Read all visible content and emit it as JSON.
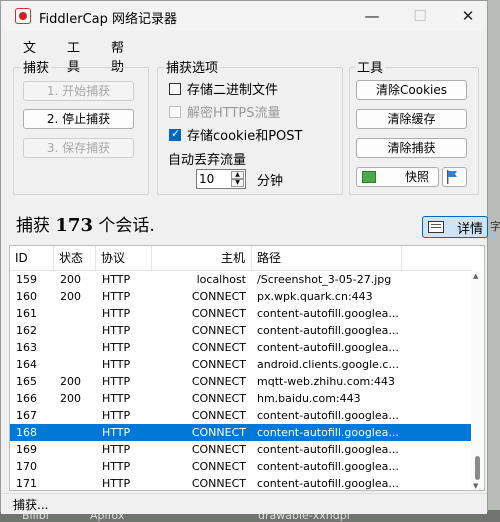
{
  "window": {
    "title": "FiddlerCap 网络记录器",
    "controls": {
      "minimize": "—",
      "maximize": "☐",
      "close": "✕"
    }
  },
  "menu": [
    "文件",
    "工具",
    "帮助"
  ],
  "capture_group": {
    "label": "捕获",
    "buttons": [
      {
        "label": "1. 开始捕获",
        "enabled": false
      },
      {
        "label": "2. 停止捕获",
        "enabled": true
      },
      {
        "label": "3. 保存捕获",
        "enabled": false
      }
    ]
  },
  "options_group": {
    "label": "捕获选项",
    "checkboxes": [
      {
        "label": "存储二进制文件",
        "checked": false,
        "enabled": true
      },
      {
        "label": "解密HTTPS流量",
        "checked": false,
        "enabled": false
      },
      {
        "label": "存储cookie和POST",
        "checked": true,
        "enabled": true
      }
    ],
    "auto_discard_label": "自动丢弃流量",
    "minutes_value": "10",
    "minutes_unit": "分钟"
  },
  "tools_group": {
    "label": "工具",
    "buttons": [
      "清除Cookies",
      "清除缓存",
      "清除捕获"
    ],
    "snapshot_label": "快照"
  },
  "summary": {
    "prefix": "捕获",
    "count": "173",
    "suffix": "个会话."
  },
  "details_button": "详情",
  "columns": [
    "ID",
    "状态",
    "协议",
    "主机",
    "路径"
  ],
  "rows": [
    {
      "id": "159",
      "status": "200",
      "protocol": "HTTP",
      "host": "localhost",
      "path": "/Screenshot_3-05-27.jpg",
      "selected": false
    },
    {
      "id": "160",
      "status": "200",
      "protocol": "HTTP",
      "host": "CONNECT",
      "path": "px.wpk.quark.cn:443",
      "selected": false
    },
    {
      "id": "161",
      "status": "",
      "protocol": "HTTP",
      "host": "CONNECT",
      "path": "content-autofill.googlea...",
      "selected": false
    },
    {
      "id": "162",
      "status": "",
      "protocol": "HTTP",
      "host": "CONNECT",
      "path": "content-autofill.googlea...",
      "selected": false
    },
    {
      "id": "163",
      "status": "",
      "protocol": "HTTP",
      "host": "CONNECT",
      "path": "content-autofill.googlea...",
      "selected": false
    },
    {
      "id": "164",
      "status": "",
      "protocol": "HTTP",
      "host": "CONNECT",
      "path": "android.clients.google.c...",
      "selected": false
    },
    {
      "id": "165",
      "status": "200",
      "protocol": "HTTP",
      "host": "CONNECT",
      "path": "mqtt-web.zhihu.com:443",
      "selected": false
    },
    {
      "id": "166",
      "status": "200",
      "protocol": "HTTP",
      "host": "CONNECT",
      "path": "hm.baidu.com:443",
      "selected": false
    },
    {
      "id": "167",
      "status": "",
      "protocol": "HTTP",
      "host": "CONNECT",
      "path": "content-autofill.googlea...",
      "selected": false
    },
    {
      "id": "168",
      "status": "",
      "protocol": "HTTP",
      "host": "CONNECT",
      "path": "content-autofill.googlea...",
      "selected": true
    },
    {
      "id": "169",
      "status": "",
      "protocol": "HTTP",
      "host": "CONNECT",
      "path": "content-autofill.googlea...",
      "selected": false
    },
    {
      "id": "170",
      "status": "",
      "protocol": "HTTP",
      "host": "CONNECT",
      "path": "content-autofill.googlea...",
      "selected": false
    },
    {
      "id": "171",
      "status": "",
      "protocol": "HTTP",
      "host": "CONNECT",
      "path": "content-autofill.googlea...",
      "selected": false
    }
  ],
  "status_text": "捕获...",
  "background": {
    "right_glyph": "字",
    "taskbar": [
      "Bilibi",
      "Apifox",
      "drawable-xxhdpi"
    ]
  },
  "colors": {
    "selection": "#0078d7",
    "accent": "#0067c0",
    "record_red": "#d41f1f"
  }
}
